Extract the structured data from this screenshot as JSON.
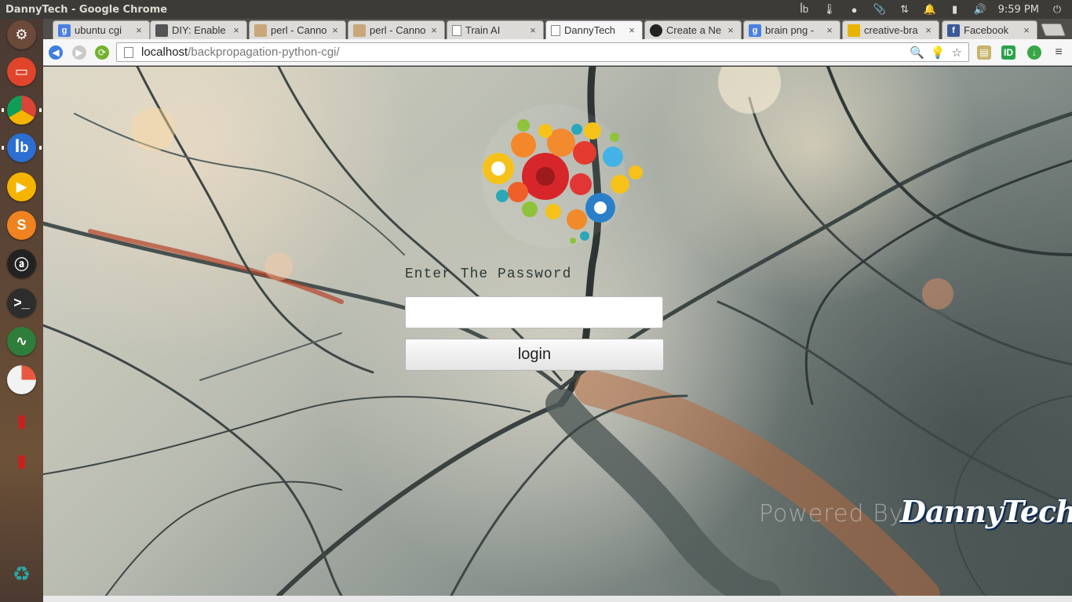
{
  "topbar": {
    "window_title": "DannyTech - Google Chrome",
    "clock": "9:59 PM",
    "indicators": [
      "qbittorrent-icon",
      "thermometer-icon",
      "chrome-indicator-icon",
      "paperclip-icon",
      "network-arrows-icon",
      "notification-bell-icon",
      "battery-icon",
      "volume-icon",
      "clock",
      "power-icon"
    ]
  },
  "launcher": {
    "items": [
      {
        "name": "ubuntu-dash-icon",
        "color": "#6b4a3a"
      },
      {
        "name": "files-icon",
        "color": "#e0452c"
      },
      {
        "name": "chrome-icon",
        "color": "#ffffff"
      },
      {
        "name": "qbittorrent-icon",
        "color": "#2c6fd1"
      },
      {
        "name": "media-player-icon",
        "color": "#f5b400"
      },
      {
        "name": "sublime-text-icon",
        "color": "#f0831f"
      },
      {
        "name": "app-icon",
        "color": "#222222"
      },
      {
        "name": "terminal-icon",
        "color": "#2d2d2d"
      },
      {
        "name": "system-monitor-icon",
        "color": "#2f7d3a"
      },
      {
        "name": "disk-usage-icon",
        "color": "#e9e9e9"
      },
      {
        "name": "extinguisher-icon",
        "color": "#c8201f"
      },
      {
        "name": "extinguisher-icon-2",
        "color": "#c8201f"
      },
      {
        "name": "trash-icon",
        "color": "#2aa6a6"
      }
    ]
  },
  "tabs": [
    {
      "title": "ubuntu cgi",
      "favicon": "google-icon",
      "fav_color": "#4a7fe0",
      "active": false
    },
    {
      "title": "DIY: Enable",
      "favicon": "diy-icon",
      "fav_color": "#555555",
      "active": false
    },
    {
      "title": "perl - Canno",
      "favicon": "stackoverflow-icon",
      "fav_color": "#c9a77a",
      "active": false
    },
    {
      "title": "perl - Canno",
      "favicon": "stackoverflow-icon",
      "fav_color": "#c9a77a",
      "active": false
    },
    {
      "title": "Train AI",
      "favicon": "page-icon",
      "fav_color": "#ffffff",
      "active": false
    },
    {
      "title": "DannyTech",
      "favicon": "page-icon",
      "fav_color": "#ffffff",
      "active": true
    },
    {
      "title": "Create a Ne",
      "favicon": "github-icon",
      "fav_color": "#222222",
      "active": false
    },
    {
      "title": "brain png -",
      "favicon": "google-icon",
      "fav_color": "#4a7fe0",
      "active": false
    },
    {
      "title": "creative-bra",
      "favicon": "flag-icon",
      "fav_color": "#e8b400",
      "active": false
    },
    {
      "title": "Facebook",
      "favicon": "facebook-icon",
      "fav_color": "#3b5998",
      "active": false
    }
  ],
  "toolbar": {
    "url_host": "localhost",
    "url_path": "/backpropagation-python-cgi/"
  },
  "page": {
    "prompt": "Enter The Password",
    "password_value": "",
    "login_label": "login",
    "powered_by": "Powered By:",
    "brand": "DannyTech"
  }
}
